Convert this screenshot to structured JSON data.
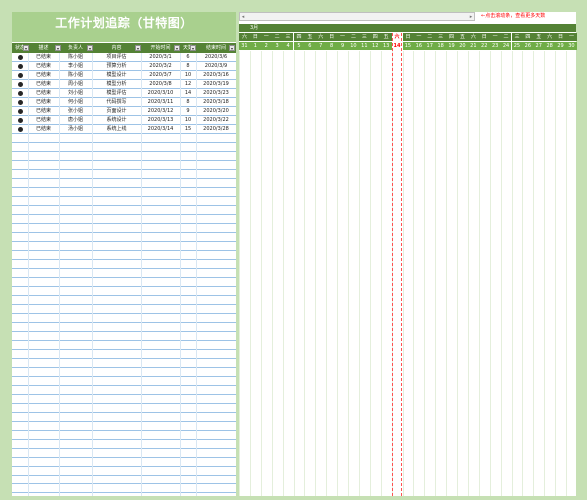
{
  "title": "工作计划追踪（甘特图）",
  "headers": [
    "状态",
    "描述",
    "负责人",
    "内容",
    "开始时间",
    "天数",
    "结束时间"
  ],
  "rows": [
    {
      "status": "已结束",
      "owner": "陈小姐",
      "content": "项目评估",
      "start": "2020/3/1",
      "days": "6",
      "end": "2020/3/6"
    },
    {
      "status": "已结束",
      "owner": "李小姐",
      "content": "预算分析",
      "start": "2020/3/2",
      "days": "8",
      "end": "2020/3/9"
    },
    {
      "status": "已结束",
      "owner": "陈小姐",
      "content": "模型设计",
      "start": "2020/3/7",
      "days": "10",
      "end": "2020/3/16"
    },
    {
      "status": "已结束",
      "owner": "周小姐",
      "content": "模型分析",
      "start": "2020/3/8",
      "days": "12",
      "end": "2020/3/19"
    },
    {
      "status": "已结束",
      "owner": "刘小姐",
      "content": "模型评估",
      "start": "2020/3/10",
      "days": "14",
      "end": "2020/3/23"
    },
    {
      "status": "已结束",
      "owner": "何小姐",
      "content": "代码撰写",
      "start": "2020/3/11",
      "days": "8",
      "end": "2020/3/18"
    },
    {
      "status": "已结束",
      "owner": "张小姐",
      "content": "页面设计",
      "start": "2020/3/12",
      "days": "9",
      "end": "2020/3/20"
    },
    {
      "status": "已结束",
      "owner": "唐小姐",
      "content": "系统设计",
      "start": "2020/3/13",
      "days": "10",
      "end": "2020/3/22"
    },
    {
      "status": "已结束",
      "owner": "汤小姐",
      "content": "系统上线",
      "start": "2020/3/14",
      "days": "15",
      "end": "2020/3/28"
    }
  ],
  "note": "←点击滚动条，查看更多天数",
  "month_label": "3月",
  "weekdays": [
    "六",
    "日",
    "一",
    "二",
    "三",
    "四",
    "五",
    "六",
    "日",
    "一",
    "二",
    "三",
    "四",
    "五",
    "六",
    "日",
    "一",
    "二",
    "三",
    "四",
    "五",
    "六",
    "日",
    "一",
    "二",
    "三",
    "四",
    "五",
    "六",
    "日",
    "一"
  ],
  "dates": [
    "31",
    "1",
    "2",
    "3",
    "4",
    "5",
    "6",
    "7",
    "8",
    "9",
    "10",
    "11",
    "12",
    "13",
    "14",
    "15",
    "16",
    "17",
    "18",
    "19",
    "20",
    "21",
    "22",
    "23",
    "24",
    "25",
    "26",
    "27",
    "28",
    "29",
    "30"
  ],
  "today": "14",
  "colors": {
    "header_green": "#548235",
    "light_green": "#a9d08e",
    "date_green": "#70ad47",
    "today_red": "#ff0000",
    "frame": "#c6e0b4"
  }
}
